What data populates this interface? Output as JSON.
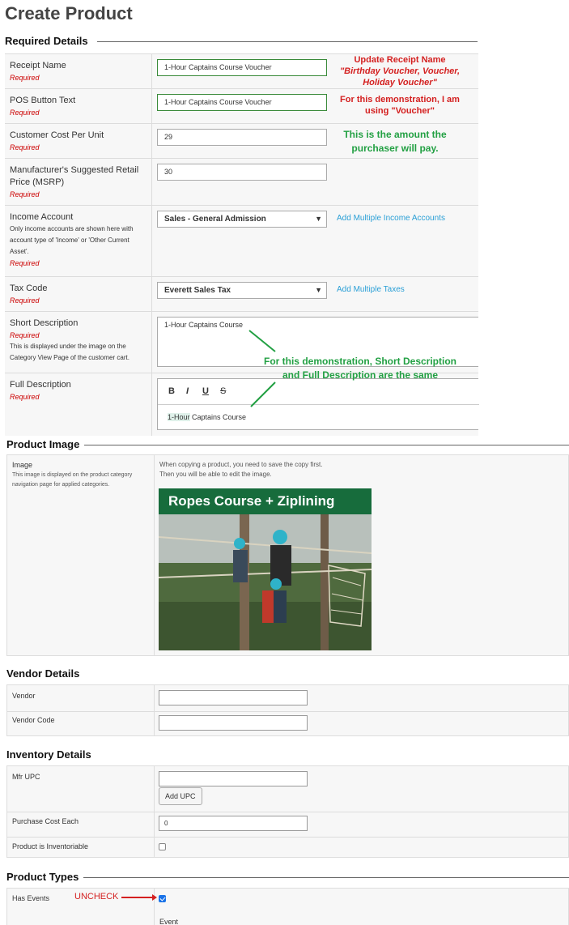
{
  "page_title": "Create Product",
  "required_section": {
    "title": "Required Details",
    "required_text": "Required",
    "receipt_name": {
      "label": "Receipt Name",
      "value": "1-Hour Captains Course Voucher"
    },
    "pos_button_text": {
      "label": "POS Button Text",
      "value": "1-Hour Captains Course Voucher"
    },
    "customer_cost": {
      "label": "Customer Cost Per Unit",
      "value": "29"
    },
    "msrp": {
      "label": "Manufacturer's Suggested Retail Price (MSRP)",
      "value": "30"
    },
    "income_account": {
      "label": "Income Account",
      "hint": "Only income accounts are shown here with account type of 'Income' or 'Other Current Asset'.",
      "selected": "Sales - General Admission",
      "link": "Add Multiple Income Accounts"
    },
    "tax_code": {
      "label": "Tax Code",
      "selected": "Everett Sales Tax",
      "link": "Add Multiple Taxes"
    },
    "short_description": {
      "label": "Short Description",
      "hint": "This is displayed under the image on the Category View Page of the customer cart.",
      "value": "1-Hour Captains Course"
    },
    "full_description": {
      "label": "Full Description",
      "toolbar": [
        "B",
        "I",
        "U",
        "S"
      ],
      "value_highlight": "1-Hour",
      "value_rest": " Captains Course"
    }
  },
  "annotations": {
    "receipt_line1": "Update Receipt Name",
    "receipt_line2": "\"Birthday Voucher, Voucher,",
    "receipt_line3": "Holiday Voucher\"",
    "pos_line1": "For this demonstration, I am",
    "pos_line2": "using \"Voucher\"",
    "cost_line1": "This is the amount the",
    "cost_line2": "purchaser will pay.",
    "desc_line1": "For this demonstration, Short Description",
    "desc_line2": "and Full Description are the same",
    "uncheck": "UNCHECK",
    "colors": {
      "red": "#d42020",
      "green": "#22a043"
    }
  },
  "product_image": {
    "title": "Product Image",
    "label": "Image",
    "hint": "This image is displayed on the product category navigation page for applied categories.",
    "note_line1": "When copying a product, you need to save the copy first.",
    "note_line2": "Then you will be able to edit the image.",
    "banner": "Ropes Course + Ziplining"
  },
  "vendor_details": {
    "title": "Vendor Details",
    "vendor_label": "Vendor",
    "vendor_value": "",
    "vendor_code_label": "Vendor Code",
    "vendor_code_value": ""
  },
  "inventory_details": {
    "title": "Inventory Details",
    "mfr_upc_label": "Mfr UPC",
    "mfr_upc_value": "",
    "add_upc_button": "Add UPC",
    "purchase_cost_label": "Purchase Cost Each",
    "purchase_cost_value": "0",
    "inventoriable_label": "Product is Inventoriable",
    "inventoriable_checked": false
  },
  "product_types": {
    "title": "Product Types",
    "has_events_label": "Has Events",
    "has_events_checked": true,
    "partial_label": "Event"
  }
}
